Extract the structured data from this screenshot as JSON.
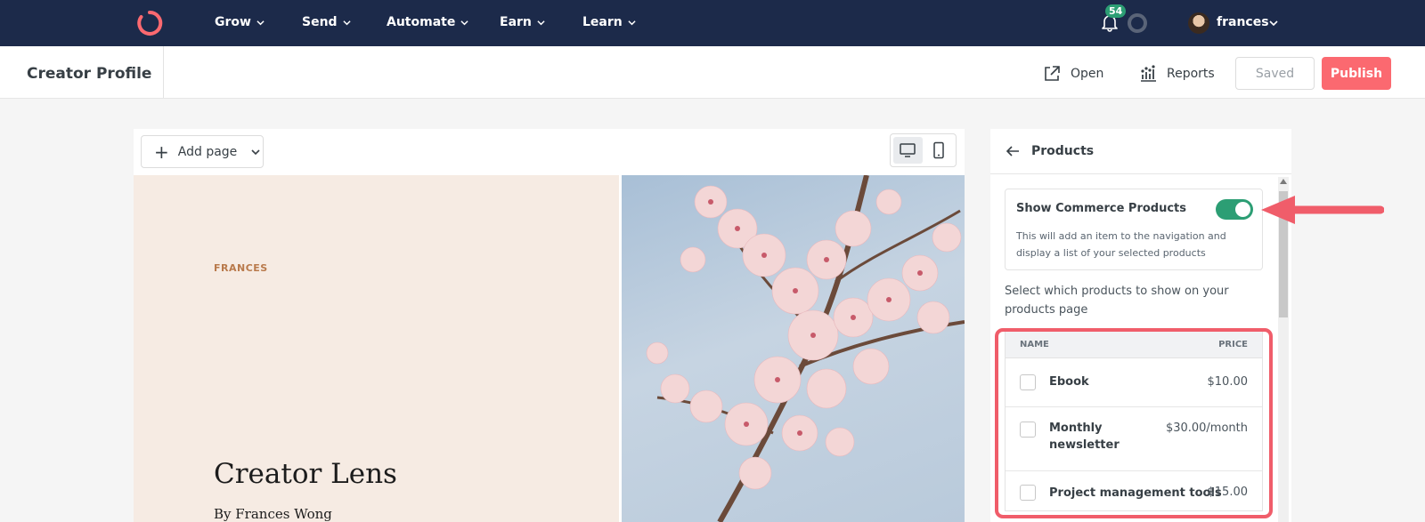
{
  "topnav": {
    "items": [
      {
        "label": "Grow"
      },
      {
        "label": "Send"
      },
      {
        "label": "Automate"
      },
      {
        "label": "Earn"
      },
      {
        "label": "Learn"
      }
    ],
    "notification_count": "54",
    "user_name": "frances"
  },
  "header": {
    "title": "Creator Profile",
    "open_label": "Open",
    "reports_label": "Reports",
    "saved_label": "Saved",
    "publish_label": "Publish"
  },
  "preview": {
    "add_page_label": "Add page",
    "eyebrow": "FRANCES",
    "title": "Creator Lens",
    "subtitle": "By Frances Wong"
  },
  "panel": {
    "title": "Products",
    "toggle": {
      "title": "Show Commerce Products",
      "on": true,
      "description": "This will add an item to the navigation and display a list of your selected products"
    },
    "select_text": "Select which products to show on your products page",
    "table": {
      "col_name": "NAME",
      "col_price": "PRICE",
      "rows": [
        {
          "name": "Ebook",
          "price": "$10.00",
          "checked": false
        },
        {
          "name": "Monthly newsletter",
          "price": "$30.00/month",
          "checked": false
        },
        {
          "name": "Project management tools",
          "price": "$15.00",
          "checked": false
        }
      ]
    }
  },
  "colors": {
    "nav_bg": "#1c2a4a",
    "accent": "#fb6970",
    "toggle_on": "#2c9e74",
    "highlight": "#f05d6a",
    "hero_bg": "#f6ebe3"
  }
}
